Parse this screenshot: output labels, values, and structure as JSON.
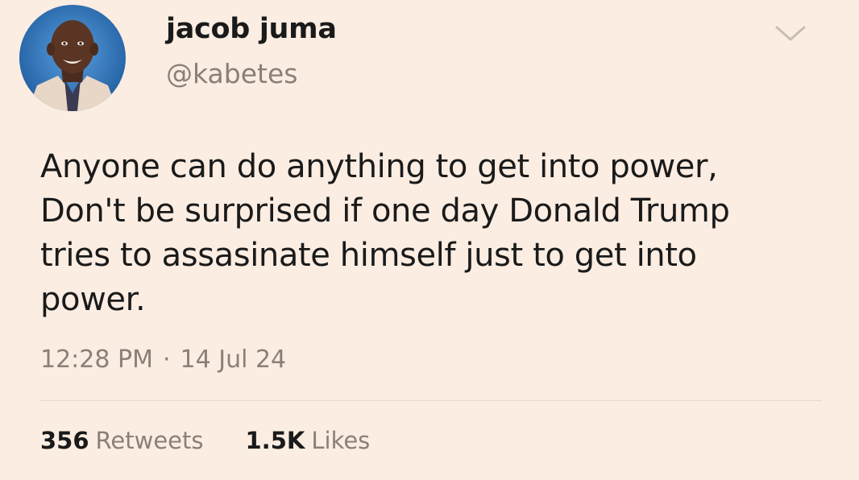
{
  "user": {
    "display_name": "jacob juma",
    "handle": "@kabetes"
  },
  "tweet": {
    "text": "Anyone can do anything to get into power,\nDon't be surprised if one day Donald Trump\ntries to assasinate himself just to get into\npower.",
    "time": "12:28 PM",
    "separator": "·",
    "date": "14 Jul 24"
  },
  "stats": {
    "retweets_count": "356",
    "retweets_label": "Retweets",
    "likes_count": "1.5K",
    "likes_label": "Likes"
  },
  "icons": {
    "menu": "chevron-down-icon",
    "avatar": "avatar"
  },
  "colors": {
    "background": "#fbede2",
    "text": "#1a1a1a",
    "muted": "#8a8079",
    "avatar_bg": "#2f6fb3"
  }
}
